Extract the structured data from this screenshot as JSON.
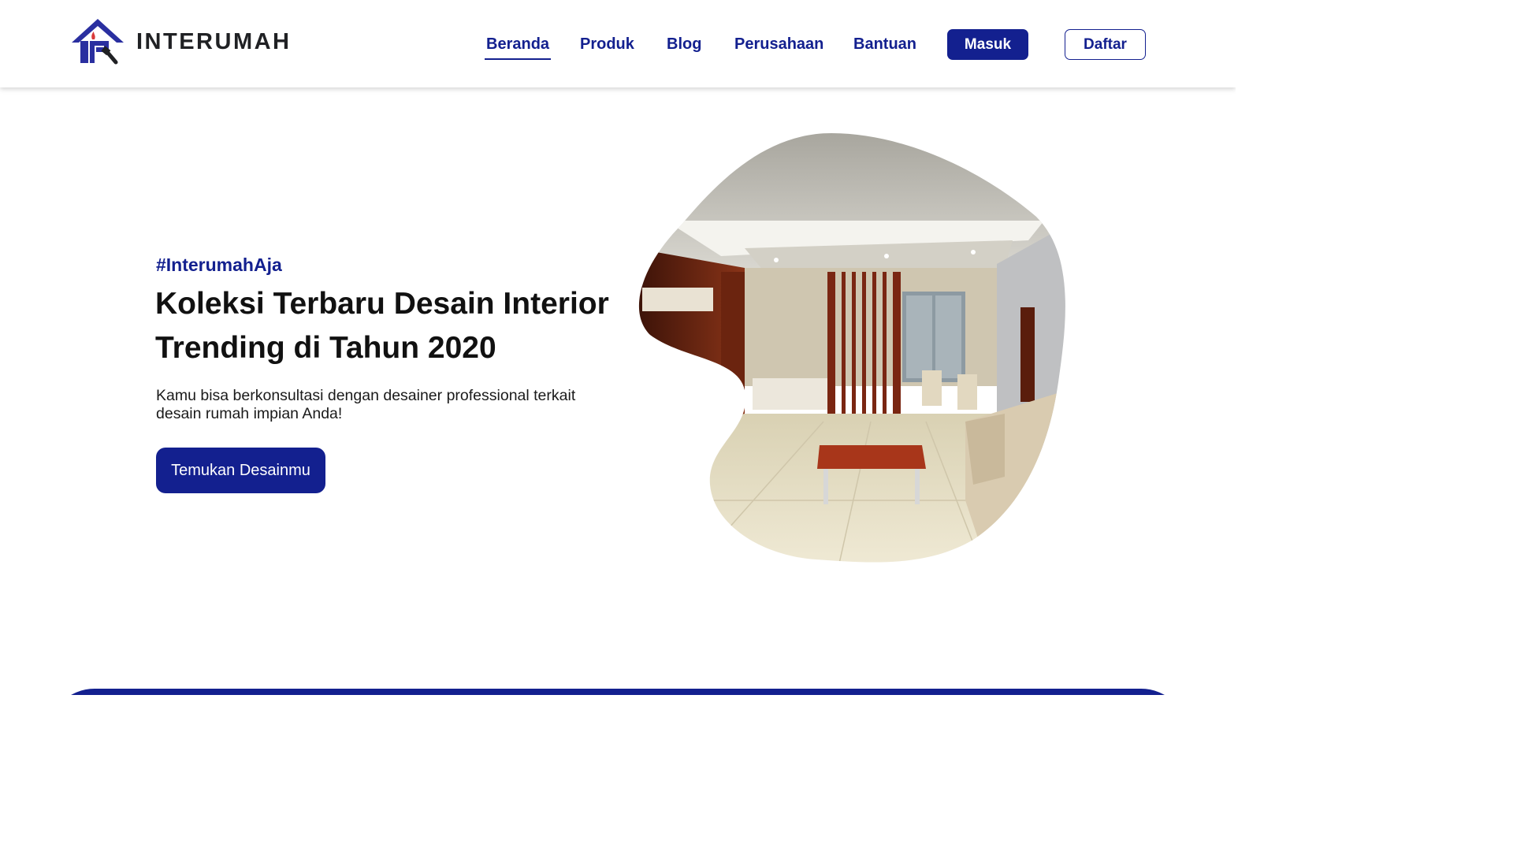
{
  "brand": {
    "name": "INTERUMAH",
    "logo_icon": "house-brush-logo"
  },
  "nav": {
    "links": [
      "Beranda",
      "Produk",
      "Blog",
      "Perusahaan",
      "Bantuan"
    ],
    "active": "Beranda",
    "login_label": "Masuk",
    "register_label": "Daftar"
  },
  "hero": {
    "tagline": "#InterumahAja",
    "headline_line1": "Koleksi Terbaru Desain Interior",
    "headline_line2": "Trending di Tahun 2020",
    "subtitle_line1": "Kamu bisa berkonsultasi dengan desainer professional terkait",
    "subtitle_line2": "desain rumah impian Anda!",
    "cta_label": "Temukan Desainmu",
    "image_subject": "modern interior living room"
  },
  "colors": {
    "primary": "#13208f",
    "text": "#111111",
    "background": "#ffffff"
  }
}
